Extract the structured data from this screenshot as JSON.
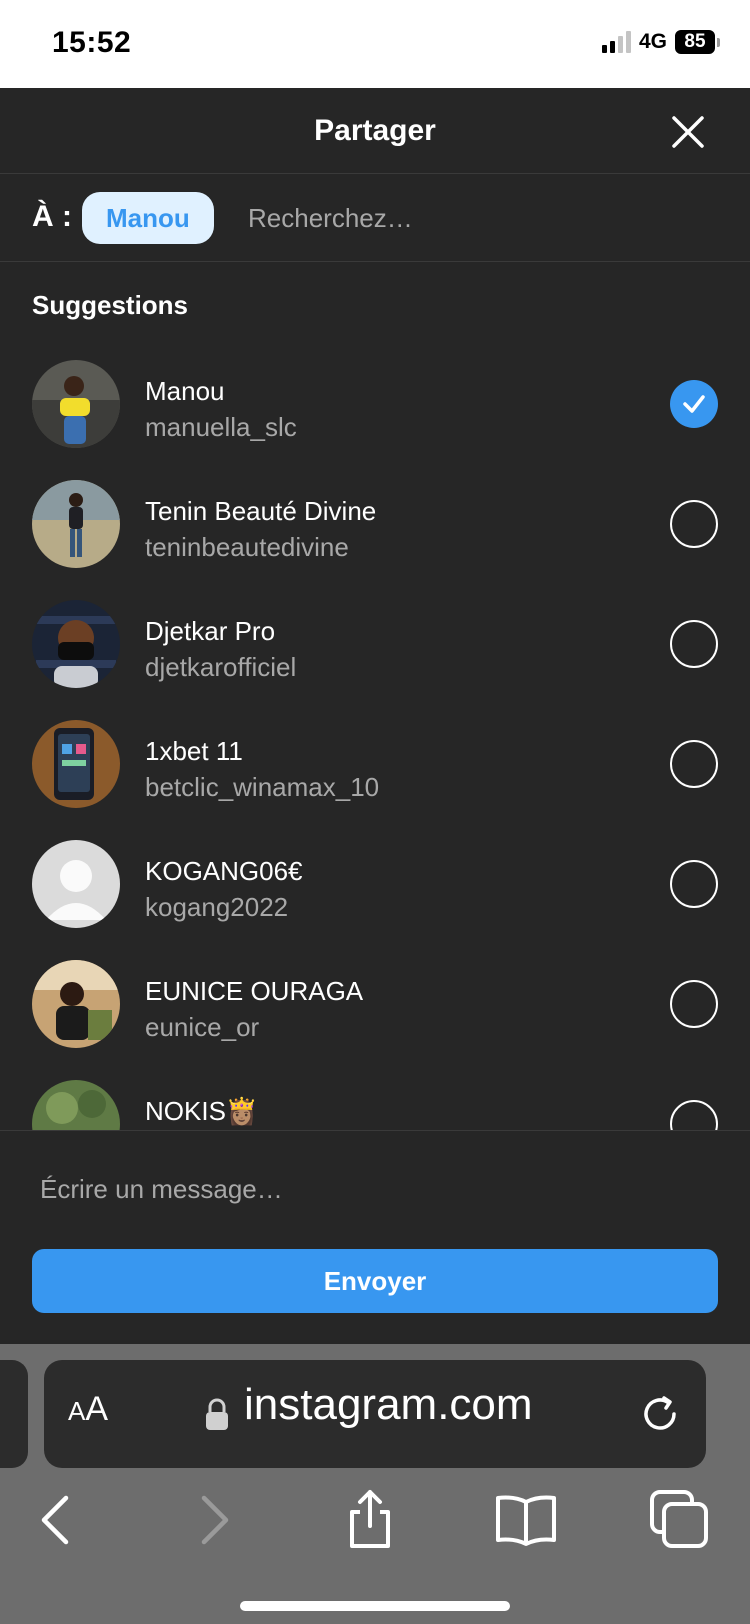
{
  "status_bar": {
    "time": "15:52",
    "network": "4G",
    "battery": "85"
  },
  "header": {
    "title": "Partager"
  },
  "recipients": {
    "to_label": "À :",
    "selected_chip": "Manou",
    "search_placeholder": "Recherchez…"
  },
  "suggestions": {
    "title": "Suggestions",
    "items": [
      {
        "name": "Manou",
        "handle": "manuella_slc",
        "selected": true
      },
      {
        "name": "Tenin Beauté Divine",
        "handle": "teninbeautedivine",
        "selected": false
      },
      {
        "name": "Djetkar Pro",
        "handle": "djetkarofficiel",
        "selected": false
      },
      {
        "name": "1xbet 11",
        "handle": "betclic_winamax_10",
        "selected": false
      },
      {
        "name": "KOGANG06€",
        "handle": "kogang2022",
        "selected": false
      },
      {
        "name": "EUNICE OURAGA",
        "handle": "eunice_or",
        "selected": false
      },
      {
        "name": "NOKIS👸🏽",
        "handle": "",
        "selected": false
      }
    ]
  },
  "composer": {
    "placeholder": "Écrire un message…",
    "send_label": "Envoyer"
  },
  "browser": {
    "aa_label_small": "A",
    "aa_label_large": "A",
    "url": "instagram.com"
  },
  "colors": {
    "accent": "#3897f0",
    "background": "#262626",
    "chip_bg": "#e0f1ff"
  }
}
